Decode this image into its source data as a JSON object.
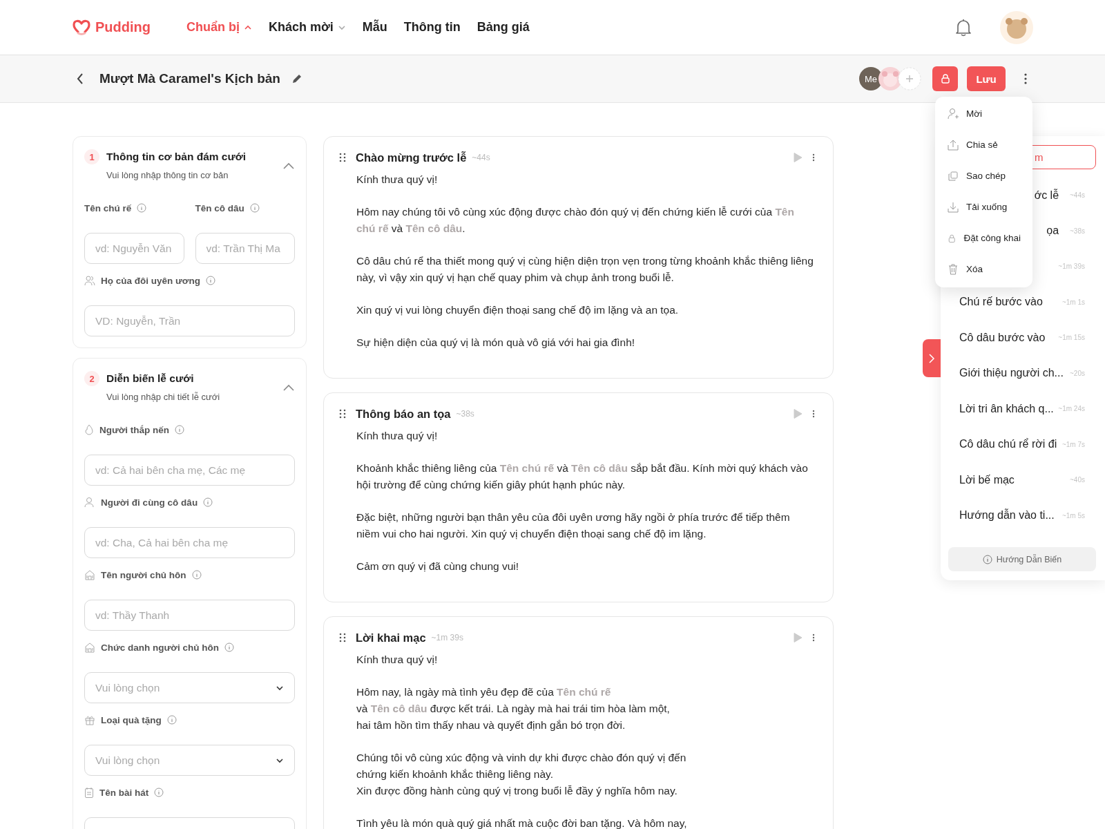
{
  "header": {
    "logo": "Pudding",
    "nav": [
      {
        "label": "Chuẩn bị",
        "selected": true,
        "has_menu": true
      },
      {
        "label": "Khách mời",
        "selected": false,
        "has_menu": true
      },
      {
        "label": "Mẫu",
        "selected": false,
        "has_menu": false
      },
      {
        "label": "Thông tin",
        "selected": false,
        "has_menu": false
      },
      {
        "label": "Bảng giá",
        "selected": false,
        "has_menu": false
      }
    ]
  },
  "toolbar": {
    "title": "Mượt Mà Caramel's Kịch bản",
    "me_avatar": "Me",
    "save": "Lưu"
  },
  "menu": [
    {
      "label": "Mời"
    },
    {
      "label": "Chia sẻ"
    },
    {
      "label": "Sao chép"
    },
    {
      "label": "Tải xuống"
    },
    {
      "label": "Đặt công khai"
    },
    {
      "label": "Xóa"
    }
  ],
  "sections": [
    {
      "number": "1",
      "title": "Thông tin cơ bản đám cưới",
      "subtitle": "Vui lòng nhập thông tin cơ bản",
      "expanded": true,
      "fields": [
        {
          "kind": "pair",
          "items": [
            {
              "label": "Tên chú rế",
              "placeholder": "vd: Nguyễn Văn"
            },
            {
              "label": "Tên cô dâu",
              "placeholder": "vd: Trần Thị Ma"
            }
          ]
        },
        {
          "kind": "input",
          "label": "Họ của đôi uyên ương",
          "placeholder": "VD: Nguyễn, Trần"
        }
      ]
    },
    {
      "number": "2",
      "title": "Diễn biến lễ cưới",
      "subtitle": "Vui lòng nhập chi tiết lễ cưới",
      "expanded": true,
      "fields": [
        {
          "kind": "input",
          "label": "Người thắp nến",
          "placeholder": "vd: Cả hai bên cha mẹ, Các mẹ"
        },
        {
          "kind": "input",
          "label": "Người đi cùng cô dâu",
          "placeholder": "vd: Cha, Cả hai bên cha mẹ"
        },
        {
          "kind": "input",
          "label": "Tên người chủ hôn",
          "placeholder": "vd: Thầy Thanh"
        },
        {
          "kind": "select",
          "label": "Chức danh người chủ hôn",
          "placeholder": "Vui lòng chọn"
        },
        {
          "kind": "select",
          "label": "Loại quà tặng",
          "placeholder": "Vui lòng chọn"
        },
        {
          "kind": "input",
          "label": "Tên bài hát"
        }
      ]
    }
  ],
  "scripts": [
    {
      "title": "Chào mừng trước lễ",
      "duration": "~44s",
      "paragraphs": [
        [
          "Kính thưa quý vị!"
        ],
        [
          "Hôm nay chúng tôi vô cùng xúc động được chào đón quý vị đến chứng kiến lễ cưới của **Tên chú rế** và **Tên cô dâu**."
        ],
        [
          "Cô dâu chú rể tha thiết mong quý vị cùng hiện diện trọn vẹn trong từng khoảnh khắc thiêng liêng này, vì vậy xin quý vị hạn chế quay phim và chụp ảnh trong buổi lễ."
        ],
        [
          "Xin quý vị vui lòng chuyển điện thoại sang chế độ im lặng và an tọa."
        ],
        [
          "Sự hiện diện của quý vị là món quà vô giá với hai gia đình!"
        ]
      ]
    },
    {
      "title": "Thông báo an tọa",
      "duration": "~38s",
      "paragraphs": [
        [
          "Kính thưa quý vị!"
        ],
        [
          "Khoảnh khắc thiêng liêng của **Tên chú rế** và **Tên cô dâu** sắp bắt đầu. Kính mời quý khách vào hội trường để cùng chứng kiến giây phút hạnh phúc này."
        ],
        [
          "Đặc biệt, những người bạn thân yêu của đôi uyên ương hãy ngồi ở phía trước để tiếp thêm niềm vui cho hai người. Xin quý vị chuyển điện thoại sang chế độ im lặng."
        ],
        [
          "Cảm ơn quý vị đã cùng chung vui!"
        ]
      ]
    },
    {
      "title": "Lời khai mạc",
      "duration": "~1m 39s",
      "paragraphs": [
        [
          "Kính thưa quý vị!"
        ],
        [
          "Hôm nay, là ngày mà tình yêu đẹp đẽ của **Tên chú rế**",
          "và **Tên cô dâu** được kết trái. Là ngày mà hai trái tim hòa làm một,",
          "hai tâm hồn tìm thấy nhau và quyết định gắn bó trọn đời."
        ],
        [
          "Chúng tôi vô cùng xúc động và vinh dự khi được chào đón quý vị đến",
          "chứng kiến khoảnh khắc thiêng liêng này.",
          "Xin được đồng hành cùng quý vị trong buổi lễ đầy ý nghĩa hôm nay."
        ],
        [
          "Tình yêu là món quà quý giá nhất mà cuộc đời ban tặng. Và hôm nay,"
        ]
      ]
    }
  ],
  "outline": {
    "button": "m",
    "items": [
      {
        "title_end": "ớc lễ",
        "duration": "~44s"
      },
      {
        "title_end": "ọa",
        "duration": "~38s"
      },
      {
        "duration": "~1m 39s"
      },
      {
        "title": "Chú rế bước vào",
        "duration": "~1m 1s"
      },
      {
        "title": "Cô dâu bước vào",
        "duration": "~1m 15s"
      },
      {
        "title": "Giới thiệu người ch...",
        "duration": "~20s"
      },
      {
        "title": "Lời tri ân khách q...",
        "duration": "~1m 24s"
      },
      {
        "title": "Cô dâu chú rể rời đi",
        "duration": "~1m 7s"
      },
      {
        "title": "Lời bế mạc",
        "duration": "~40s"
      },
      {
        "title": "Hướng dẫn vào ti...",
        "duration": "~1m 5s"
      }
    ],
    "guide": "Hướng Dẫn Biến"
  }
}
